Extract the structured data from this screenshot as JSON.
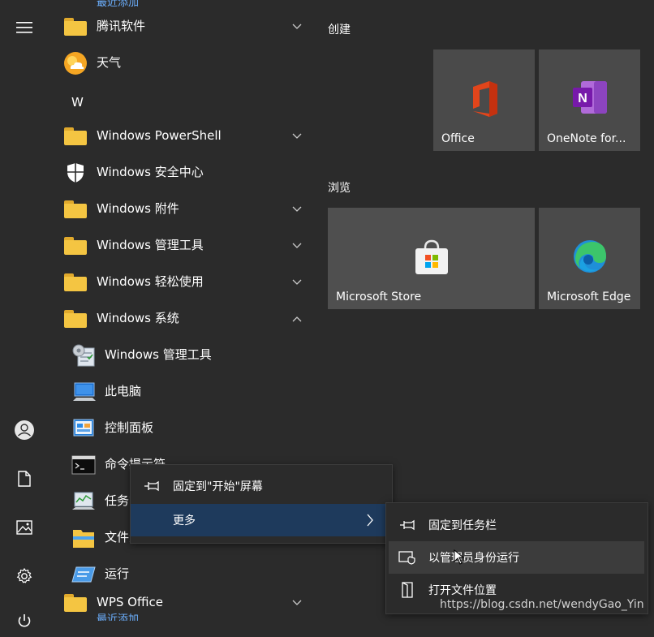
{
  "applist": {
    "top_cut_label": "最近添加",
    "rows": [
      {
        "label": "腾讯软件",
        "expand": "down"
      },
      {
        "label": "天气"
      },
      {
        "label": "W"
      },
      {
        "label": "Windows PowerShell",
        "expand": "down"
      },
      {
        "label": "Windows 安全中心"
      },
      {
        "label": "Windows 附件",
        "expand": "down"
      },
      {
        "label": "Windows 管理工具",
        "expand": "down"
      },
      {
        "label": "Windows 轻松使用",
        "expand": "down"
      },
      {
        "label": "Windows 系统",
        "expand": "up"
      },
      {
        "label": "Windows 管理工具"
      },
      {
        "label": "此电脑"
      },
      {
        "label": "控制面板"
      },
      {
        "label": "命令提示符"
      },
      {
        "label": "任务管理器"
      },
      {
        "label": "文件资源管理器"
      },
      {
        "label": "运行"
      },
      {
        "label": "WPS Office",
        "expand": "down"
      }
    ],
    "bottom_cut_label": "最近添加"
  },
  "tiles": {
    "group1": "创建",
    "group2": "浏览",
    "office": "Office",
    "onenote": "OneNote for...",
    "store": "Microsoft Store",
    "edge": "Microsoft Edge"
  },
  "context_menu": {
    "pin_start": "固定到\"开始\"屏幕",
    "more": "更多"
  },
  "submenu": {
    "pin_taskbar": "固定到任务栏",
    "run_admin": "以管理员身份运行",
    "open_location": "打开文件位置"
  },
  "watermark": "https://blog.csdn.net/wendyGao_Yin",
  "colors": {
    "accent": "#1e3a5c",
    "background": "#2b2b2b",
    "tile": "#4a4a4a"
  }
}
